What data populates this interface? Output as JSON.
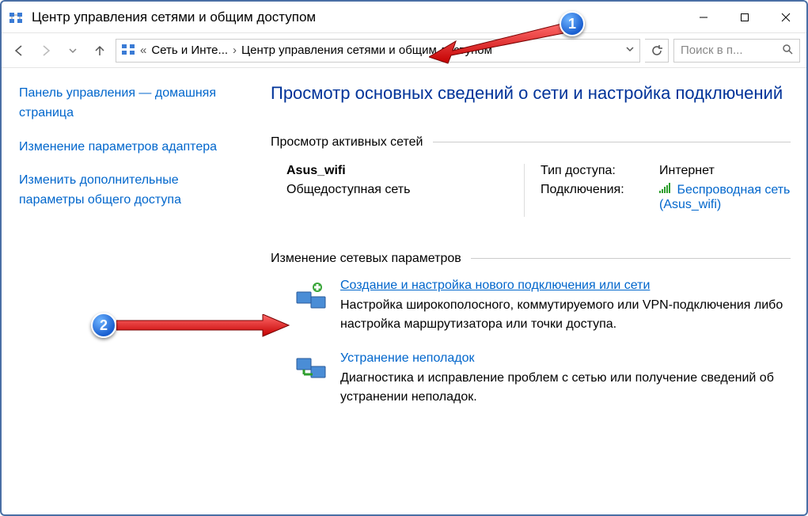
{
  "window": {
    "title": "Центр управления сетями и общим доступом"
  },
  "breadcrumbs": {
    "level1": "Сеть и Инте...",
    "level2": "Центр управления сетями и общим доступом"
  },
  "search": {
    "placeholder": "Поиск в п..."
  },
  "sidebar": {
    "home": "Панель управления — домашняя страница",
    "adapter": "Изменение параметров адаптера",
    "sharing": "Изменить дополнительные параметры общего доступа"
  },
  "main": {
    "heading": "Просмотр основных сведений о сети и настройка подключений",
    "active_nets_legend": "Просмотр активных сетей",
    "net": {
      "name": "Asus_wifi",
      "type": "Общедоступная сеть",
      "access_label": "Тип доступа:",
      "access_value": "Интернет",
      "conn_label": "Подключения:",
      "conn_link": "Беспроводная сеть (Asus_wifi)"
    },
    "change_legend": "Изменение сетевых параметров",
    "task1": {
      "link": "Создание и настройка нового подключения или сети",
      "desc": "Настройка широкополосного, коммутируемого или VPN-подключения либо настройка маршрутизатора или точки доступа."
    },
    "task2": {
      "link": "Устранение неполадок",
      "desc": "Диагностика и исправление проблем с сетью или получение сведений об устранении неполадок."
    }
  },
  "annotations": {
    "badge1": "1",
    "badge2": "2"
  }
}
